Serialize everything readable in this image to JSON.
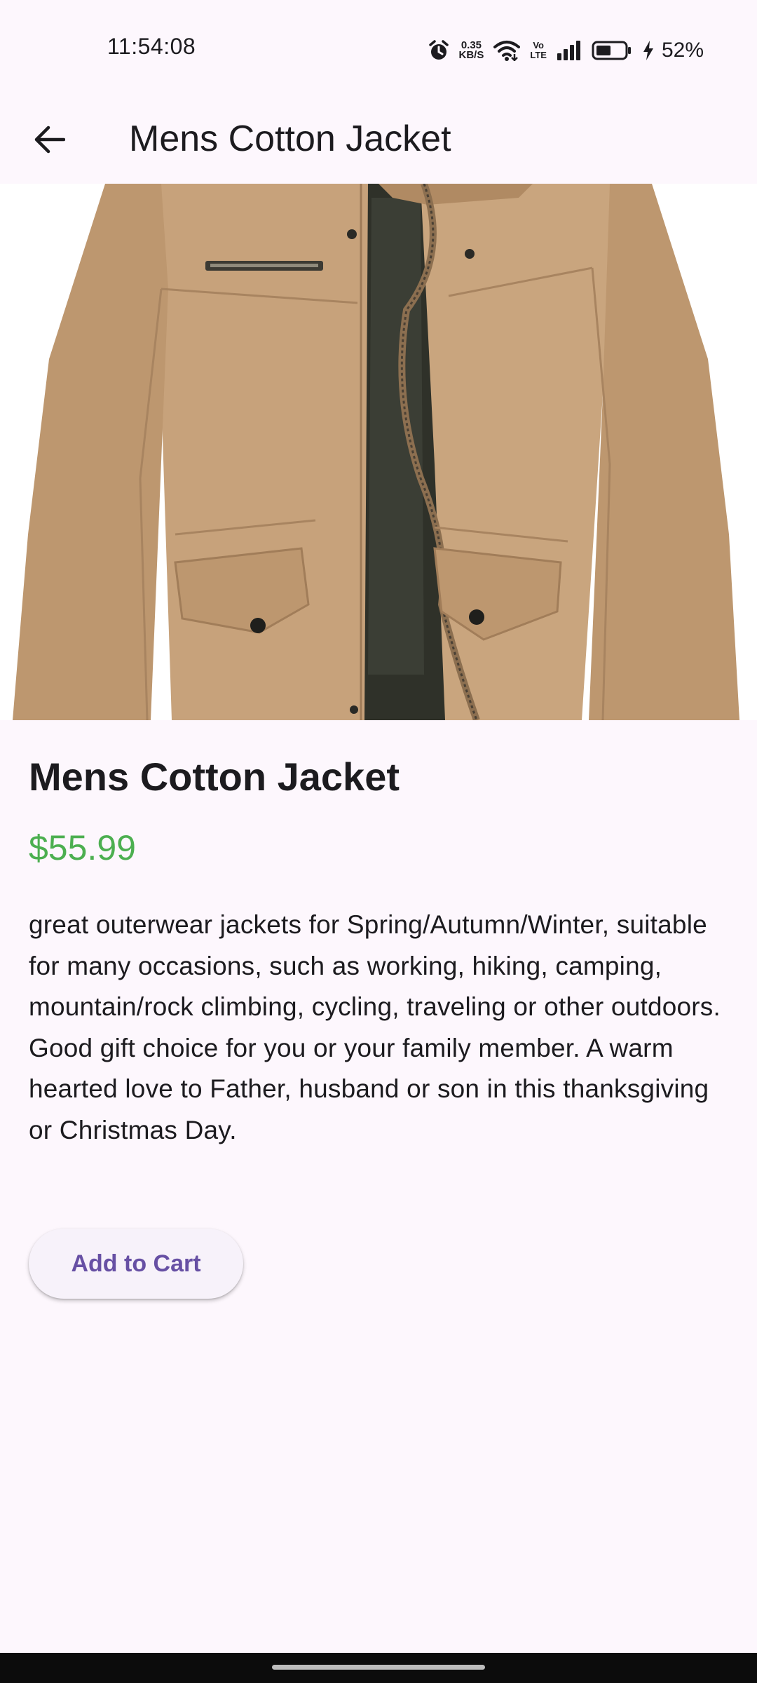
{
  "status_bar": {
    "time": "11:54:08",
    "net_speed_value": "0.35",
    "net_speed_unit": "KB/S",
    "volte_top": "Vo",
    "volte_bottom": "LTE",
    "battery_percent": "52%",
    "battery_level": 0.52,
    "icons": [
      "alarm-icon",
      "wifi-icon",
      "signal-icon",
      "battery-icon",
      "charging-icon"
    ]
  },
  "app_bar": {
    "title": "Mens Cotton Jacket",
    "back_icon": "arrow-back-icon"
  },
  "product": {
    "title": "Mens Cotton Jacket",
    "price": "$55.99",
    "description": "great outerwear jackets for Spring/Autumn/Winter, suitable for many occasions, such as working, hiking, camping, mountain/rock climbing, cycling, traveling or other outdoors. Good gift choice for you or your family member. A warm hearted love to Father, husband or son in this thanksgiving or Christmas Day.",
    "add_to_cart_label": "Add to Cart"
  },
  "colors": {
    "background": "#fdf7fd",
    "price": "#4caf50",
    "button_text": "#6750a4",
    "jacket": "#c9a37c"
  }
}
